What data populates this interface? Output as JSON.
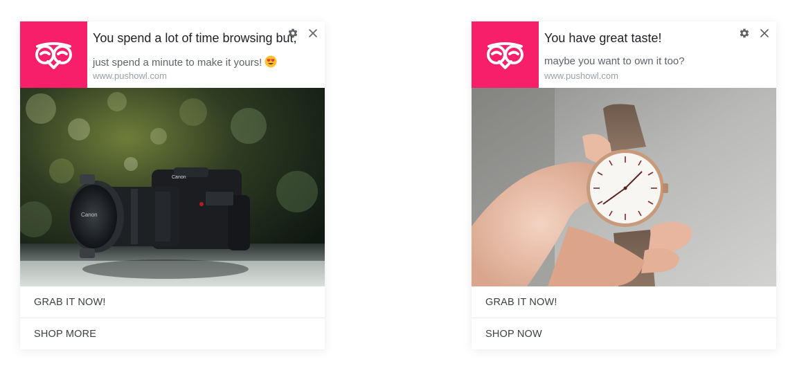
{
  "colors": {
    "brand": "#f81f6a",
    "title_text": "#202124",
    "body_text": "#5f6368",
    "url_text": "#9aa0a6",
    "icon": "#5f6368"
  },
  "notifications": [
    {
      "logo_icon": "owl-logo-icon",
      "title": "You spend a lot of time browsing but,",
      "body": "just spend a minute to make it yours!",
      "body_emoji": "heart-eyes-emoji",
      "url": "www.pushowl.com",
      "settings_icon": "gear-icon",
      "close_icon": "close-icon",
      "image": "camera-photo",
      "actions": [
        "GRAB IT NOW!",
        "SHOP MORE"
      ]
    },
    {
      "logo_icon": "owl-logo-icon",
      "title": "You have great taste!",
      "body": "maybe you want to own it too?",
      "url": "www.pushowl.com",
      "settings_icon": "gear-icon",
      "close_icon": "close-icon",
      "image": "wristwatch-photo",
      "actions": [
        "GRAB IT NOW!",
        "SHOP NOW"
      ]
    }
  ]
}
